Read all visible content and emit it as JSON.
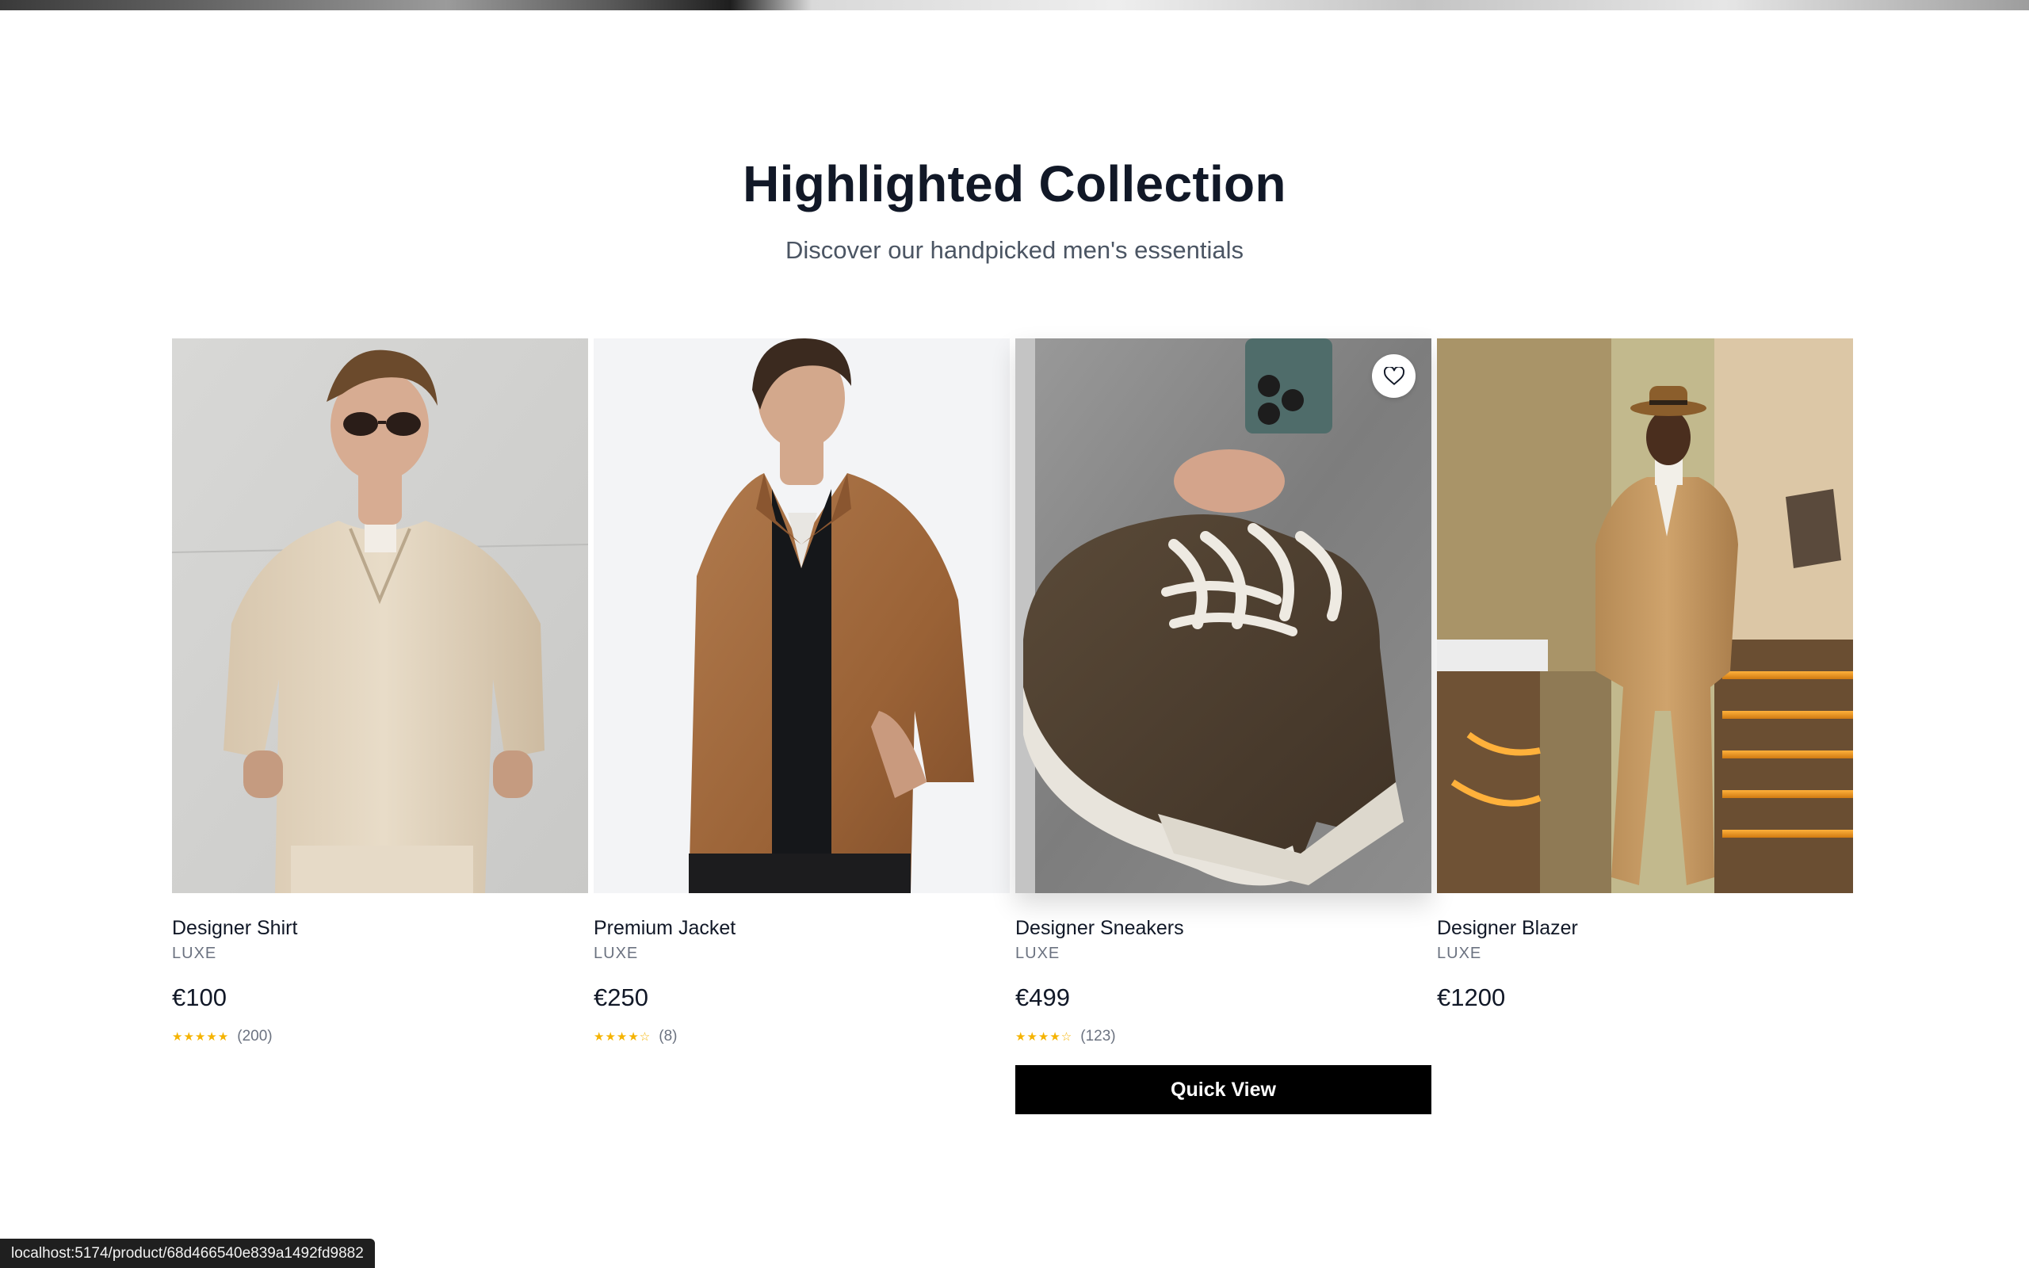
{
  "section": {
    "title": "Highlighted Collection",
    "subtitle": "Discover our handpicked men's essentials"
  },
  "products": [
    {
      "name": "Designer Shirt",
      "brand": "LUXE",
      "price": "€100",
      "stars": "★★★★★",
      "rating": 5,
      "reviews": "(200)",
      "image": "man in beige short-sleeve shirt with sunglasses"
    },
    {
      "name": "Premium Jacket",
      "brand": "LUXE",
      "price": "€250",
      "stars": "★★★★☆",
      "rating": 4,
      "reviews": "(8)",
      "image": "man in tan suede zip jacket"
    },
    {
      "name": "Designer Sneakers",
      "brand": "LUXE",
      "price": "€499",
      "stars": "★★★★☆",
      "rating": 4,
      "reviews": "(123)",
      "image": "hand holding brown suede platform sneakers",
      "quick_view_label": "Quick View"
    },
    {
      "name": "Designer Blazer",
      "brand": "LUXE",
      "price": "€1200",
      "image": "man in camel blazer and hat by lit stairs"
    }
  ],
  "status_bar": {
    "url": "localhost:5174/product/68d466540e839a1492fd9882"
  },
  "icons": {
    "wishlist": "heart-icon"
  },
  "colors": {
    "accent": "#000000",
    "star": "#f5b301",
    "heading": "#111827"
  }
}
